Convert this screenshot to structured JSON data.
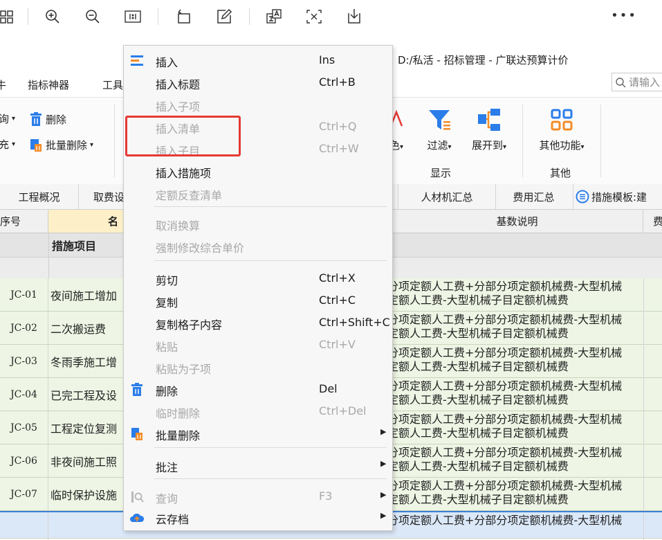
{
  "app": {
    "title": "D:/私活 - 招标管理 - 广联达预算计价",
    "menu_bar": {
      "left_partial": "牛",
      "indicator_tool": "指标神器",
      "tools_partial": "工具"
    },
    "search_placeholder": "请输入"
  },
  "ribbon": {
    "query_partial": "询",
    "fill_partial": "充",
    "delete_label": "删除",
    "batch_delete_label": "批量删除",
    "color_partial": "色",
    "filter_label": "过滤",
    "expand_label": "展开到",
    "other_func_label": "其他功能",
    "group_display": "显示",
    "group_other": "其他"
  },
  "tabs": {
    "overview": "工程概况",
    "fee_partial": "取费设",
    "labor_summary": "人材机汇总",
    "cost_summary": "费用汇总",
    "template": "措施模板:建"
  },
  "grid": {
    "headers": {
      "seq": "序号",
      "name_partial": "名",
      "base_desc": "基数说明",
      "fee_partial": "费"
    },
    "section_title": "措施项目",
    "rows": [
      {
        "code": "JC-01",
        "name": "夜间施工增加",
        "desc1": "分项定额人工费+分部分项定额机械费-大型机械",
        "desc2": "定额人工费-大型机械子目定额机械费"
      },
      {
        "code": "JC-02",
        "name": "二次搬运费",
        "desc1": "分项定额人工费+分部分项定额机械费-大型机械",
        "desc2": "定额人工费-大型机械子目定额机械费"
      },
      {
        "code": "JC-03",
        "name": "冬雨季施工增",
        "desc1": "分项定额人工费+分部分项定额机械费-大型机械",
        "desc2": "定额人工费-大型机械子目定额机械费"
      },
      {
        "code": "JC-04",
        "name": "已完工程及设",
        "desc1": "分项定额人工费+分部分项定额机械费-大型机械",
        "desc2": "定额人工费-大型机械子目定额机械费"
      },
      {
        "code": "JC-05",
        "name": "工程定位复测",
        "desc1": "分项定额人工费+分部分项定额机械费-大型机械",
        "desc2": "定额人工费-大型机械子目定额机械费"
      },
      {
        "code": "JC-06",
        "name": "非夜间施工照",
        "desc1": "分项定额人工费+分部分项定额机械费-大型机械",
        "desc2": "定额人工费-大型机械子目定额机械费"
      },
      {
        "code": "JC-07",
        "name": "临时保护设施",
        "desc1": "分项定额人工费+分部分项定额机械费-大型机械",
        "desc2": "定额人工费-大型机械子目定额机械费"
      },
      {
        "code": "",
        "name": "",
        "desc1": "分项定额人工费+分部分项定额机械费-大型机械",
        "desc2": ""
      }
    ]
  },
  "context_menu": {
    "items": [
      {
        "label": "插入",
        "shortcut": "Ins"
      },
      {
        "label": "插入标题",
        "shortcut": "Ctrl+B"
      },
      {
        "label": "插入子项",
        "shortcut": ""
      },
      {
        "label": "插入清单",
        "shortcut": "Ctrl+Q"
      },
      {
        "label": "插入子目",
        "shortcut": "Ctrl+W"
      },
      {
        "label": "插入措施项",
        "shortcut": ""
      },
      {
        "label": "定额反查清单",
        "shortcut": ""
      },
      {
        "label": "取消换算",
        "shortcut": ""
      },
      {
        "label": "强制修改综合单价",
        "shortcut": ""
      },
      {
        "label": "剪切",
        "shortcut": "Ctrl+X"
      },
      {
        "label": "复制",
        "shortcut": "Ctrl+C"
      },
      {
        "label": "复制格子内容",
        "shortcut": "Ctrl+Shift+C"
      },
      {
        "label": "粘贴",
        "shortcut": "Ctrl+V"
      },
      {
        "label": "粘贴为子项",
        "shortcut": ""
      },
      {
        "label": "删除",
        "shortcut": "Del"
      },
      {
        "label": "临时删除",
        "shortcut": "Ctrl+Del"
      },
      {
        "label": "批量删除",
        "shortcut": ""
      },
      {
        "label": "批注",
        "shortcut": ""
      },
      {
        "label": "查询",
        "shortcut": "F3"
      },
      {
        "label": "云存档",
        "shortcut": ""
      }
    ]
  },
  "colors": {
    "accent_blue": "#2b7de9",
    "highlight_red": "#e53935",
    "row_green": "#eef5e4",
    "disabled_text": "#a8a8a8"
  }
}
